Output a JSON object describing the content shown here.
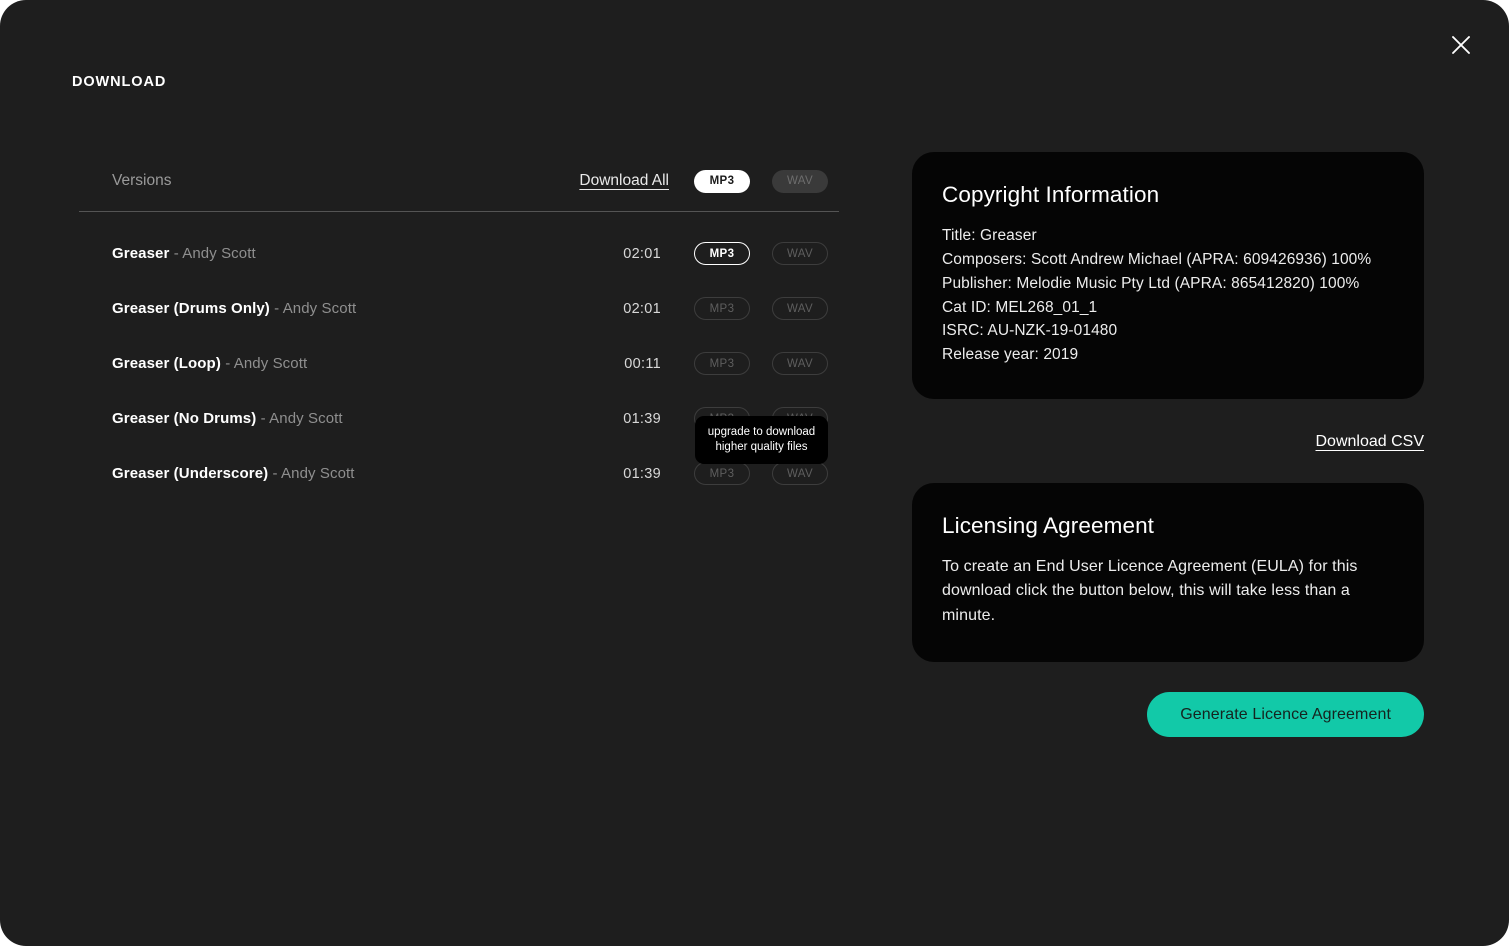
{
  "dialog": {
    "title": "DOWNLOAD",
    "close_icon": "close-icon",
    "accent_color": "#12c9a8",
    "background_color": "#1e1e1e",
    "card_color": "#050505"
  },
  "versions": {
    "header": {
      "label": "Versions",
      "download_all": "Download All",
      "mp3_label": "MP3",
      "wav_label": "WAV"
    },
    "rows": [
      {
        "title": "Greaser",
        "artist": " - Andy Scott",
        "duration": "02:01",
        "mp3_label": "MP3",
        "wav_label": "WAV",
        "mp3_state": "available",
        "wav_state": "locked"
      },
      {
        "title": "Greaser (Drums Only)",
        "artist": " - Andy Scott",
        "duration": "02:01",
        "mp3_label": "MP3",
        "wav_label": "WAV",
        "mp3_state": "locked",
        "wav_state": "locked"
      },
      {
        "title": "Greaser (Loop)",
        "artist": " - Andy Scott",
        "duration": "00:11",
        "mp3_label": "MP3",
        "wav_label": "WAV",
        "mp3_state": "locked",
        "wav_state": "locked"
      },
      {
        "title": "Greaser (No Drums)",
        "artist": " - Andy Scott",
        "duration": "01:39",
        "mp3_label": "MP3",
        "wav_label": "WAV",
        "mp3_state": "locked",
        "wav_state": "locked"
      },
      {
        "title": "Greaser (Underscore)",
        "artist": " - Andy Scott",
        "duration": "01:39",
        "mp3_label": "MP3",
        "wav_label": "WAV",
        "mp3_state": "locked",
        "wav_state": "locked"
      }
    ]
  },
  "tooltip": {
    "line1": "upgrade to download",
    "line2": "higher quality files"
  },
  "copyright": {
    "heading": "Copyright Information",
    "title": "Title: Greaser",
    "composers": "Composers: Scott Andrew Michael (APRA: 609426936) 100%",
    "publisher": "Publisher: Melodie Music Pty Ltd (APRA: 865412820) 100%",
    "cat_id": "Cat ID: MEL268_01_1",
    "isrc": "ISRC: AU-NZK-19-01480",
    "release_year": "Release year: 2019"
  },
  "download_csv": "Download CSV",
  "licensing": {
    "heading": "Licensing Agreement",
    "body": "To create an End User Licence Agreement (EULA) for this download click the button below, this will take less than a minute.",
    "button_label": "Generate Licence Agreement"
  }
}
